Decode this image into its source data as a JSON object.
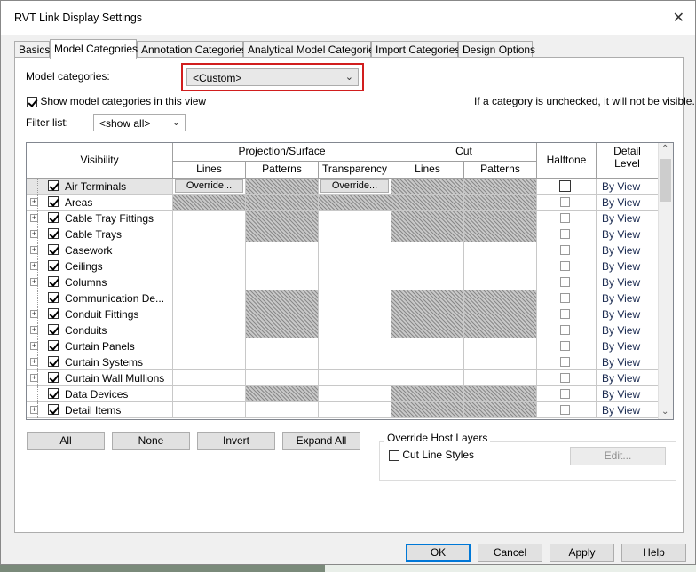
{
  "window": {
    "title": "RVT Link Display Settings",
    "close_symbol": "✕"
  },
  "tabs": [
    {
      "label": "Basics",
      "active": false
    },
    {
      "label": "Model Categories",
      "active": true
    },
    {
      "label": "Annotation Categories",
      "active": false
    },
    {
      "label": "Analytical Model Categories",
      "active": false
    },
    {
      "label": "Import Categories",
      "active": false
    },
    {
      "label": "Design Options",
      "active": false
    }
  ],
  "model_categories": {
    "label": "Model categories:",
    "selected": "<Custom>",
    "highlight_color": "#d11e1e"
  },
  "show_in_view": {
    "label": "Show model categories in this view",
    "checked": true
  },
  "hint": "If a category is unchecked, it will not be visible.",
  "filter": {
    "label": "Filter list:",
    "selected": "<show all>"
  },
  "grid": {
    "headers": {
      "visibility": "Visibility",
      "projection": "Projection/Surface",
      "proj_lines": "Lines",
      "proj_patterns": "Patterns",
      "proj_transparency": "Transparency",
      "cut": "Cut",
      "cut_lines": "Lines",
      "cut_patterns": "Patterns",
      "halftone": "Halftone",
      "detail_level": "Detail Level"
    },
    "override_label": "Override...",
    "rows": [
      {
        "name": "Air Terminals",
        "expandable": false,
        "selected": true,
        "hatch": [
          false,
          true,
          false,
          true,
          true
        ],
        "override": true
      },
      {
        "name": "Areas",
        "expandable": true,
        "hatch": [
          true,
          true,
          true,
          true,
          true
        ]
      },
      {
        "name": "Cable Tray Fittings",
        "expandable": true,
        "hatch": [
          false,
          true,
          false,
          true,
          true
        ]
      },
      {
        "name": "Cable Trays",
        "expandable": true,
        "hatch": [
          false,
          true,
          false,
          true,
          true
        ]
      },
      {
        "name": "Casework",
        "expandable": true,
        "hatch": [
          false,
          false,
          false,
          false,
          false
        ]
      },
      {
        "name": "Ceilings",
        "expandable": true,
        "hatch": [
          false,
          false,
          false,
          false,
          false
        ]
      },
      {
        "name": "Columns",
        "expandable": true,
        "hatch": [
          false,
          false,
          false,
          false,
          false
        ]
      },
      {
        "name": "Communication De...",
        "expandable": false,
        "hatch": [
          false,
          true,
          false,
          true,
          true
        ]
      },
      {
        "name": "Conduit Fittings",
        "expandable": true,
        "hatch": [
          false,
          true,
          false,
          true,
          true
        ]
      },
      {
        "name": "Conduits",
        "expandable": true,
        "hatch": [
          false,
          true,
          false,
          true,
          true
        ]
      },
      {
        "name": "Curtain Panels",
        "expandable": true,
        "hatch": [
          false,
          false,
          false,
          false,
          false
        ]
      },
      {
        "name": "Curtain Systems",
        "expandable": true,
        "hatch": [
          false,
          false,
          false,
          false,
          false
        ]
      },
      {
        "name": "Curtain Wall Mullions",
        "expandable": true,
        "hatch": [
          false,
          false,
          false,
          false,
          false
        ]
      },
      {
        "name": "Data Devices",
        "expandable": false,
        "hatch": [
          false,
          true,
          false,
          true,
          true
        ]
      },
      {
        "name": "Detail Items",
        "expandable": true,
        "hatch": [
          false,
          false,
          false,
          true,
          true
        ]
      }
    ],
    "detail_level_value": "By View"
  },
  "list_buttons": {
    "all": "All",
    "none": "None",
    "invert": "Invert",
    "expand_all": "Expand All"
  },
  "override_host": {
    "title": "Override Host Layers",
    "cut_line_styles": "Cut Line Styles",
    "edit": "Edit..."
  },
  "footer": {
    "ok": "OK",
    "cancel": "Cancel",
    "apply": "Apply",
    "help": "Help"
  }
}
